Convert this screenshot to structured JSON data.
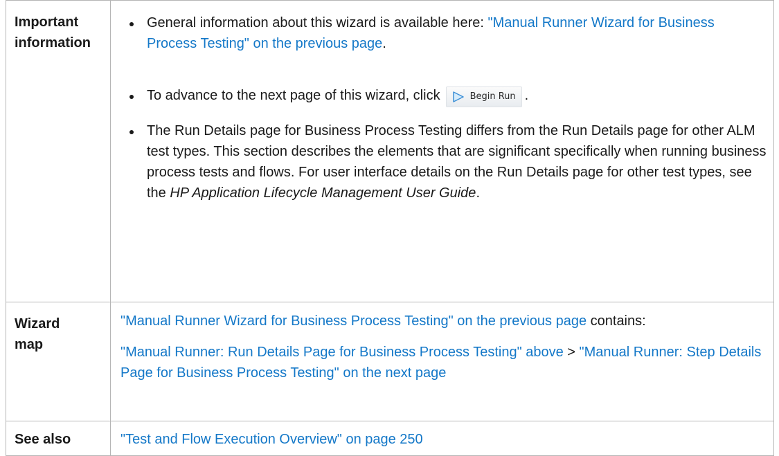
{
  "rows": {
    "important": {
      "label": "Important information",
      "bullet1": {
        "text": "General information about this wizard is available here: ",
        "link": "\"Manual Runner Wizard for Business Process Testing\" on the previous page",
        "end": "."
      },
      "bullet2": {
        "text": "To advance to the next page of this wizard, click",
        "button_label": "Begin Run",
        "button_icon": "play-arrow-icon",
        "end": "."
      },
      "bullet3": {
        "text": "The Run Details page for Business Process Testing differs from the Run Details page for other ALM test types. This section describes the elements that are significant specifically when running business process tests and flows. For user interface details on the Run Details page for other test types, see the ",
        "italic": "HP Application Lifecycle Management User Guide",
        "end": "."
      }
    },
    "wizard_map": {
      "label": "Wizard map",
      "intro_link": "\"Manual Runner Wizard for Business Process Testing\" on the previous page",
      "intro_text": " contains:",
      "path_link1": "\"Manual Runner: Run Details Page for Business Process Testing\" above",
      "separator": " > ",
      "path_link2": "\"Manual Runner: Step Details Page for Business Process Testing\" on the next page"
    },
    "see_also": {
      "label": "See also",
      "link": "\"Test and Flow Execution Overview\" on page 250"
    }
  },
  "colors": {
    "link": "#1478c8",
    "border": "#b5b5b5",
    "text": "#1a1a1a"
  }
}
